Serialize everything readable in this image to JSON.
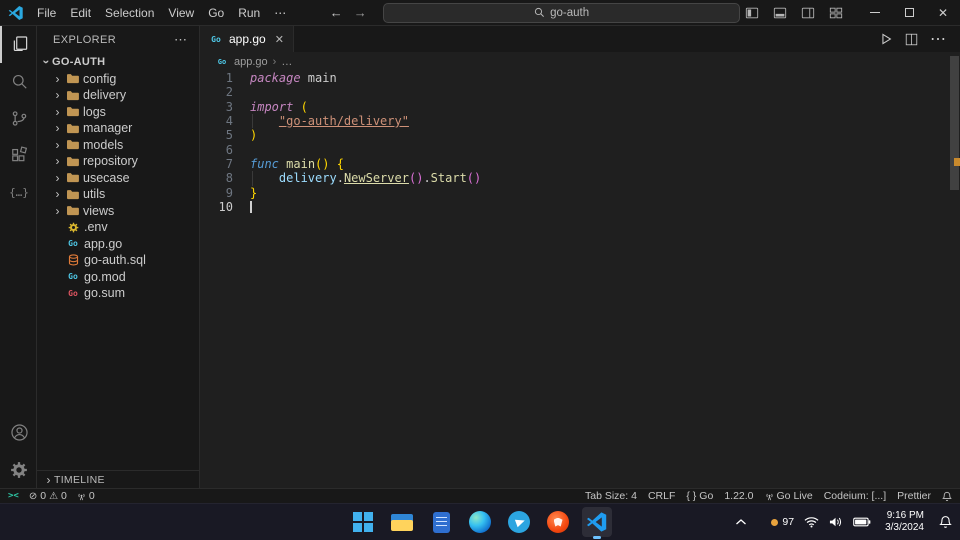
{
  "titlebar": {
    "menus": [
      "File",
      "Edit",
      "Selection",
      "View",
      "Go",
      "Run"
    ],
    "more": "⋯",
    "search": "go-auth"
  },
  "activity_bar": {
    "items": [
      "explorer",
      "search",
      "source-control",
      "extensions",
      "codeium"
    ],
    "bottom_items": [
      "account",
      "settings"
    ],
    "codeium_glyph": "{…}"
  },
  "sidebar": {
    "header": "EXPLORER",
    "root": "GO-AUTH",
    "folders": [
      "config",
      "delivery",
      "logs",
      "manager",
      "models",
      "repository",
      "usecase",
      "utils",
      "views"
    ],
    "files": [
      ".env",
      "app.go",
      "go-auth.sql",
      "go.mod",
      "go.sum"
    ],
    "timeline": "TIMELINE"
  },
  "editor": {
    "tab": "app.go",
    "breadcrumb": {
      "file": "app.go",
      "more": "…"
    },
    "code": {
      "lines": [
        {
          "num": "1",
          "tokens": [
            {
              "t": "package",
              "c": "kw"
            },
            {
              "t": " main",
              "c": "plain"
            }
          ]
        },
        {
          "num": "2",
          "tokens": []
        },
        {
          "num": "3",
          "tokens": [
            {
              "t": "import",
              "c": "kw"
            },
            {
              "t": " ",
              "c": "plain"
            },
            {
              "t": "(",
              "c": "b1"
            }
          ]
        },
        {
          "num": "4",
          "guide": true,
          "tokens": [
            {
              "t": "    ",
              "c": "plain"
            },
            {
              "t": "\"go-auth/delivery\"",
              "c": "str"
            }
          ]
        },
        {
          "num": "5",
          "tokens": [
            {
              "t": ")",
              "c": "b1"
            }
          ]
        },
        {
          "num": "6",
          "tokens": []
        },
        {
          "num": "7",
          "tokens": [
            {
              "t": "func",
              "c": "kwb"
            },
            {
              "t": " ",
              "c": "plain"
            },
            {
              "t": "main",
              "c": "fn"
            },
            {
              "t": "(",
              "c": "b1"
            },
            {
              "t": ")",
              "c": "b1"
            },
            {
              "t": " ",
              "c": "plain"
            },
            {
              "t": "{",
              "c": "b1"
            }
          ]
        },
        {
          "num": "8",
          "guide": true,
          "tokens": [
            {
              "t": "    ",
              "c": "plain"
            },
            {
              "t": "delivery",
              "c": "var"
            },
            {
              "t": ".",
              "c": "plain"
            },
            {
              "t": "NewServer",
              "c": "fnl"
            },
            {
              "t": "(",
              "c": "b2"
            },
            {
              "t": ")",
              "c": "b2"
            },
            {
              "t": ".",
              "c": "plain"
            },
            {
              "t": "Start",
              "c": "fn"
            },
            {
              "t": "(",
              "c": "b2"
            },
            {
              "t": ")",
              "c": "b2"
            }
          ]
        },
        {
          "num": "9",
          "tokens": [
            {
              "t": "}",
              "c": "b1"
            }
          ]
        },
        {
          "num": "10",
          "active": true,
          "cursor": true,
          "tokens": []
        }
      ]
    }
  },
  "statusbar": {
    "remote": "><",
    "errors": "0",
    "warnings": "0",
    "ports": "0",
    "tab_size": "Tab Size: 4",
    "eol": "CRLF",
    "lang_icon": "{ }",
    "lang": "Go",
    "go_version": "1.22.0",
    "go_live": "Go Live",
    "codeium": "Codeium: [...]",
    "prettier": "Prettier"
  },
  "taskbar": {
    "apps": [
      "start",
      "file-explorer",
      "notepad",
      "edge",
      "telegram",
      "brave",
      "vscode"
    ],
    "tray_badge": "97",
    "time": "9:16 PM",
    "date": "3/3/2024"
  },
  "icons": {
    "more": "⋯",
    "close": "✕",
    "chevron": "›",
    "error": "⊘",
    "warning": "⚠",
    "back": "←",
    "forward": "→"
  },
  "colors": {
    "accent_blue": "#0078d4",
    "go_cyan": "#4FC9E8",
    "folder_tan": "#C09553",
    "env_yellow": "#d9b62e",
    "sql_orange": "#e07b39",
    "string_orange": "#CE9178",
    "keyword_magenta": "#C586C0",
    "keyword_blue": "#569CD6",
    "function_yellow": "#DCDCAA"
  }
}
